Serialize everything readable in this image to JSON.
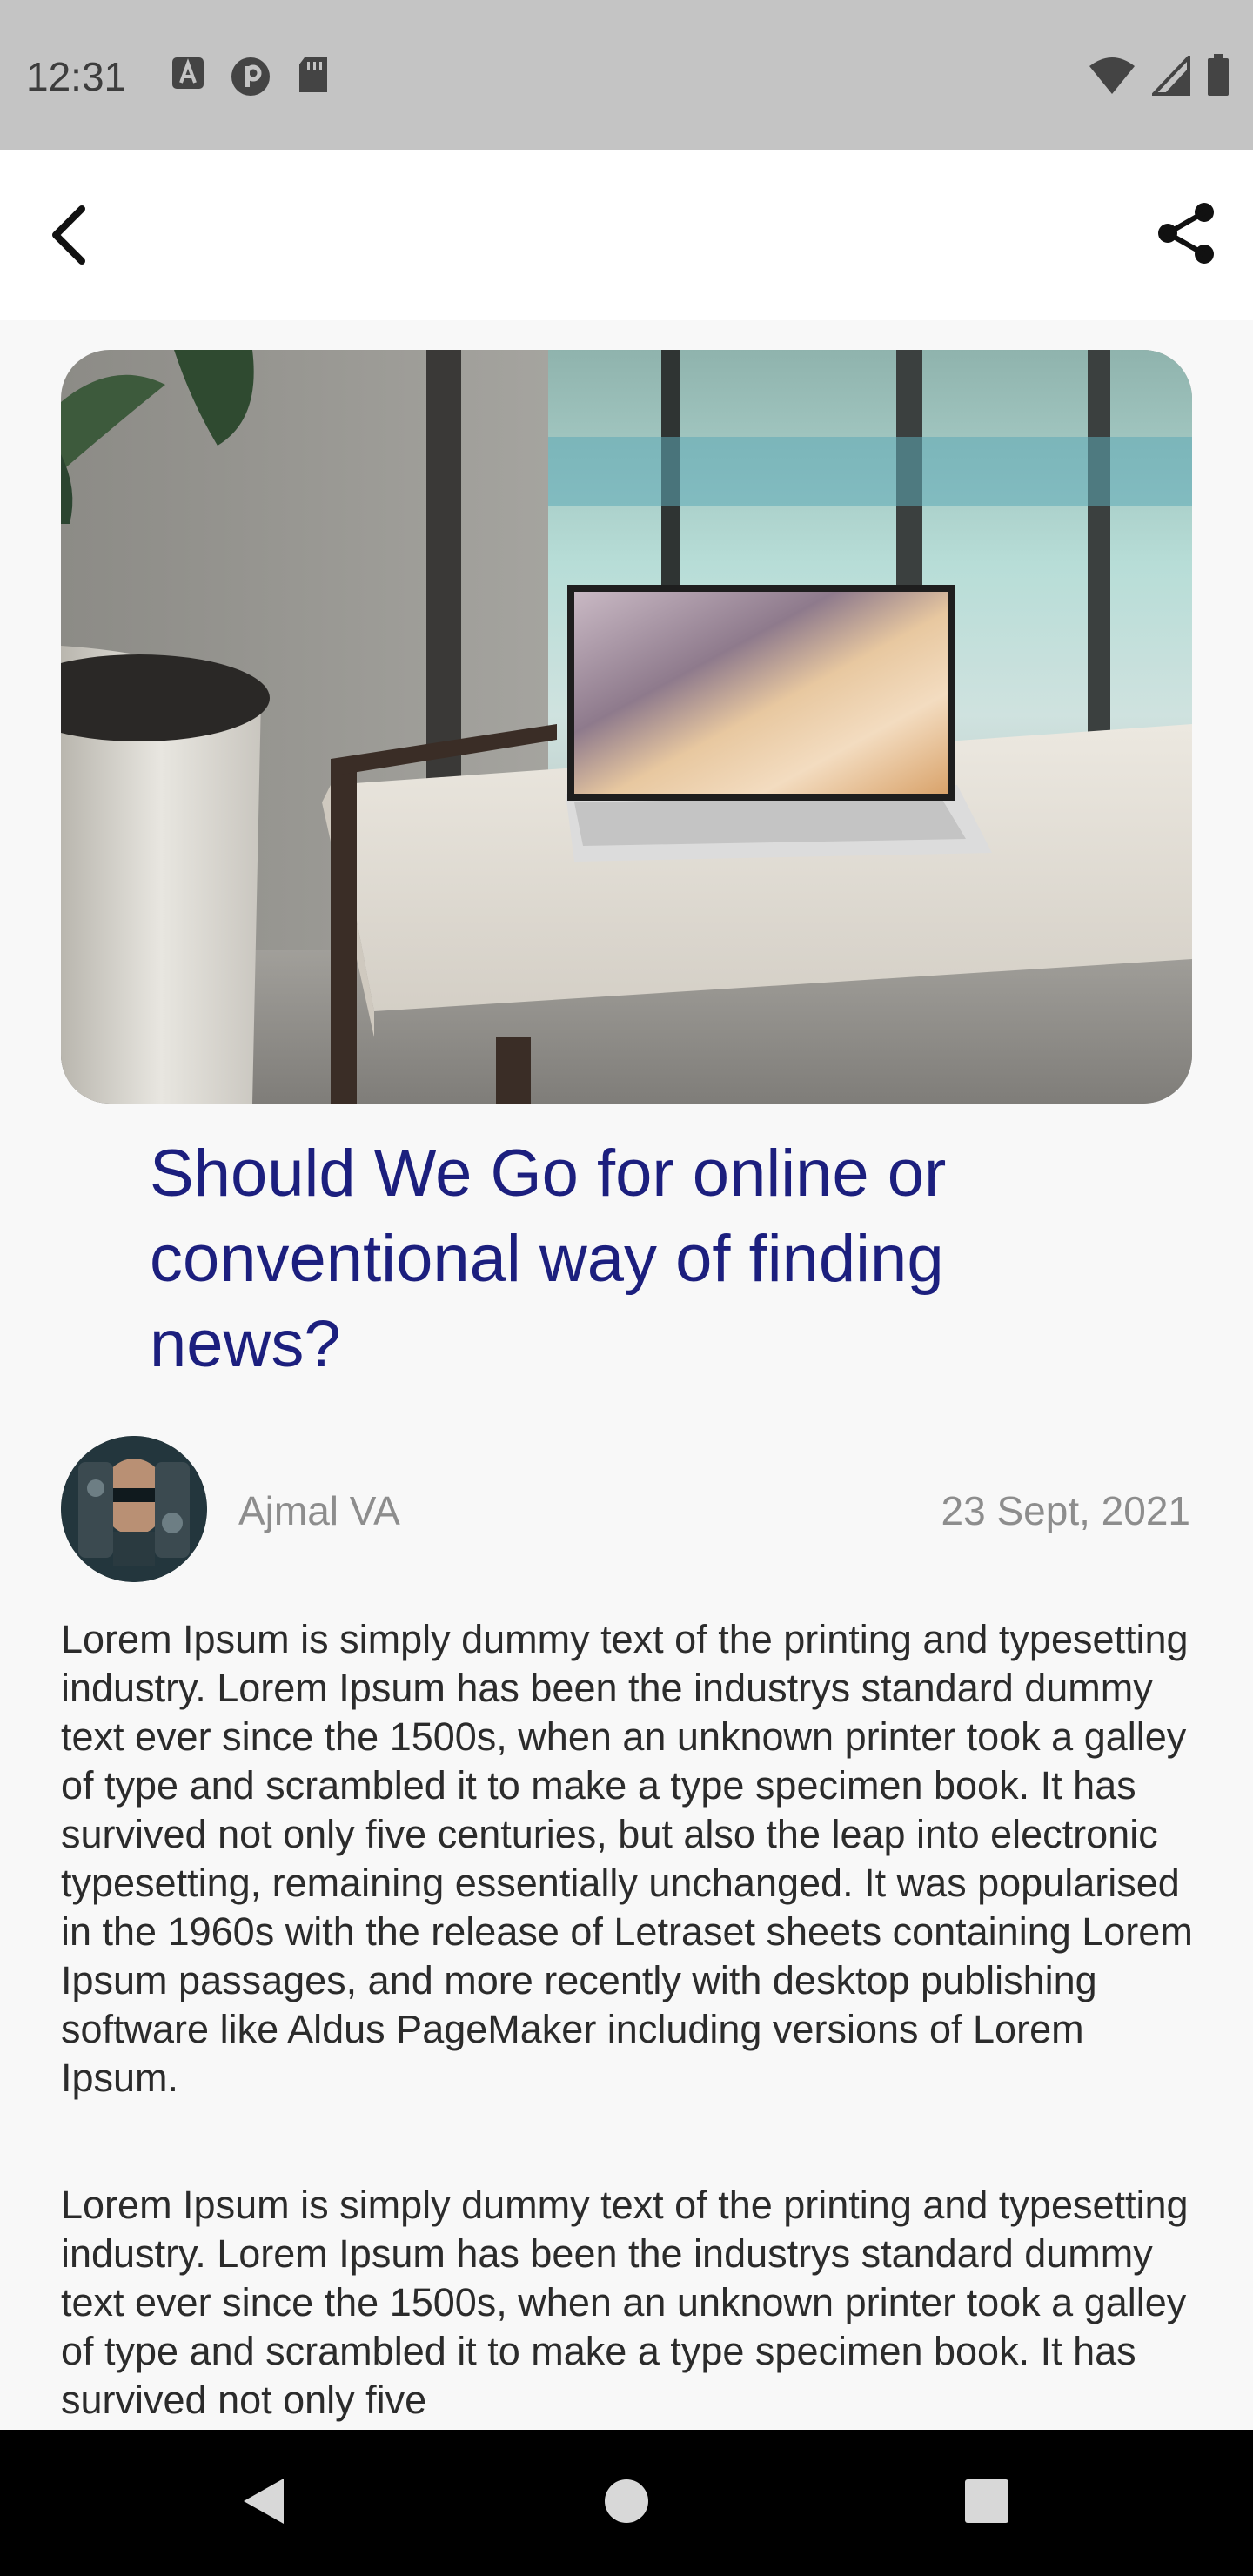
{
  "status_bar": {
    "time": "12:31",
    "left_icons": [
      "a-text-icon",
      "vpn-key-icon",
      "sd-card-icon"
    ],
    "right_icons": [
      "wifi-icon",
      "cell-signal-icon",
      "battery-icon"
    ]
  },
  "app_bar": {
    "back_icon": "chevron-left-icon",
    "share_icon": "share-icon"
  },
  "article": {
    "hero_image": "laptop-on-bench-photo",
    "title": "Should We Go for online or conventional way of finding news?",
    "author": {
      "name": "Ajmal VA",
      "avatar": "author-avatar"
    },
    "date": "23 Sept, 2021",
    "paragraphs": [
      "Lorem Ipsum is simply dummy text of the printing and typesetting industry. Lorem Ipsum has been the industrys standard dummy text ever since the 1500s, when an unknown printer took a galley of type and scrambled it to make a type specimen book. It has survived not only five centuries, but also the leap into electronic typesetting, remaining essentially unchanged. It was popularised in the 1960s with the release of Letraset sheets containing Lorem Ipsum passages, and more recently with desktop publishing software like Aldus PageMaker including versions of Lorem Ipsum.",
      "Lorem Ipsum is simply dummy text of the printing and typesetting industry. Lorem Ipsum has been the industrys standard dummy text ever since the 1500s, when an unknown printer took a galley of type and scrambled it to make a type specimen book. It has survived not only five"
    ]
  },
  "nav_bar": {
    "buttons": [
      "back-triangle-icon",
      "home-circle-icon",
      "recents-square-icon"
    ]
  },
  "colors": {
    "title": "#1c1f7e",
    "meta_text": "#8d8d8d",
    "body_text": "#2b2b2b",
    "status_bar_bg": "#c4c4c4",
    "page_bg": "#f8f8f8"
  }
}
